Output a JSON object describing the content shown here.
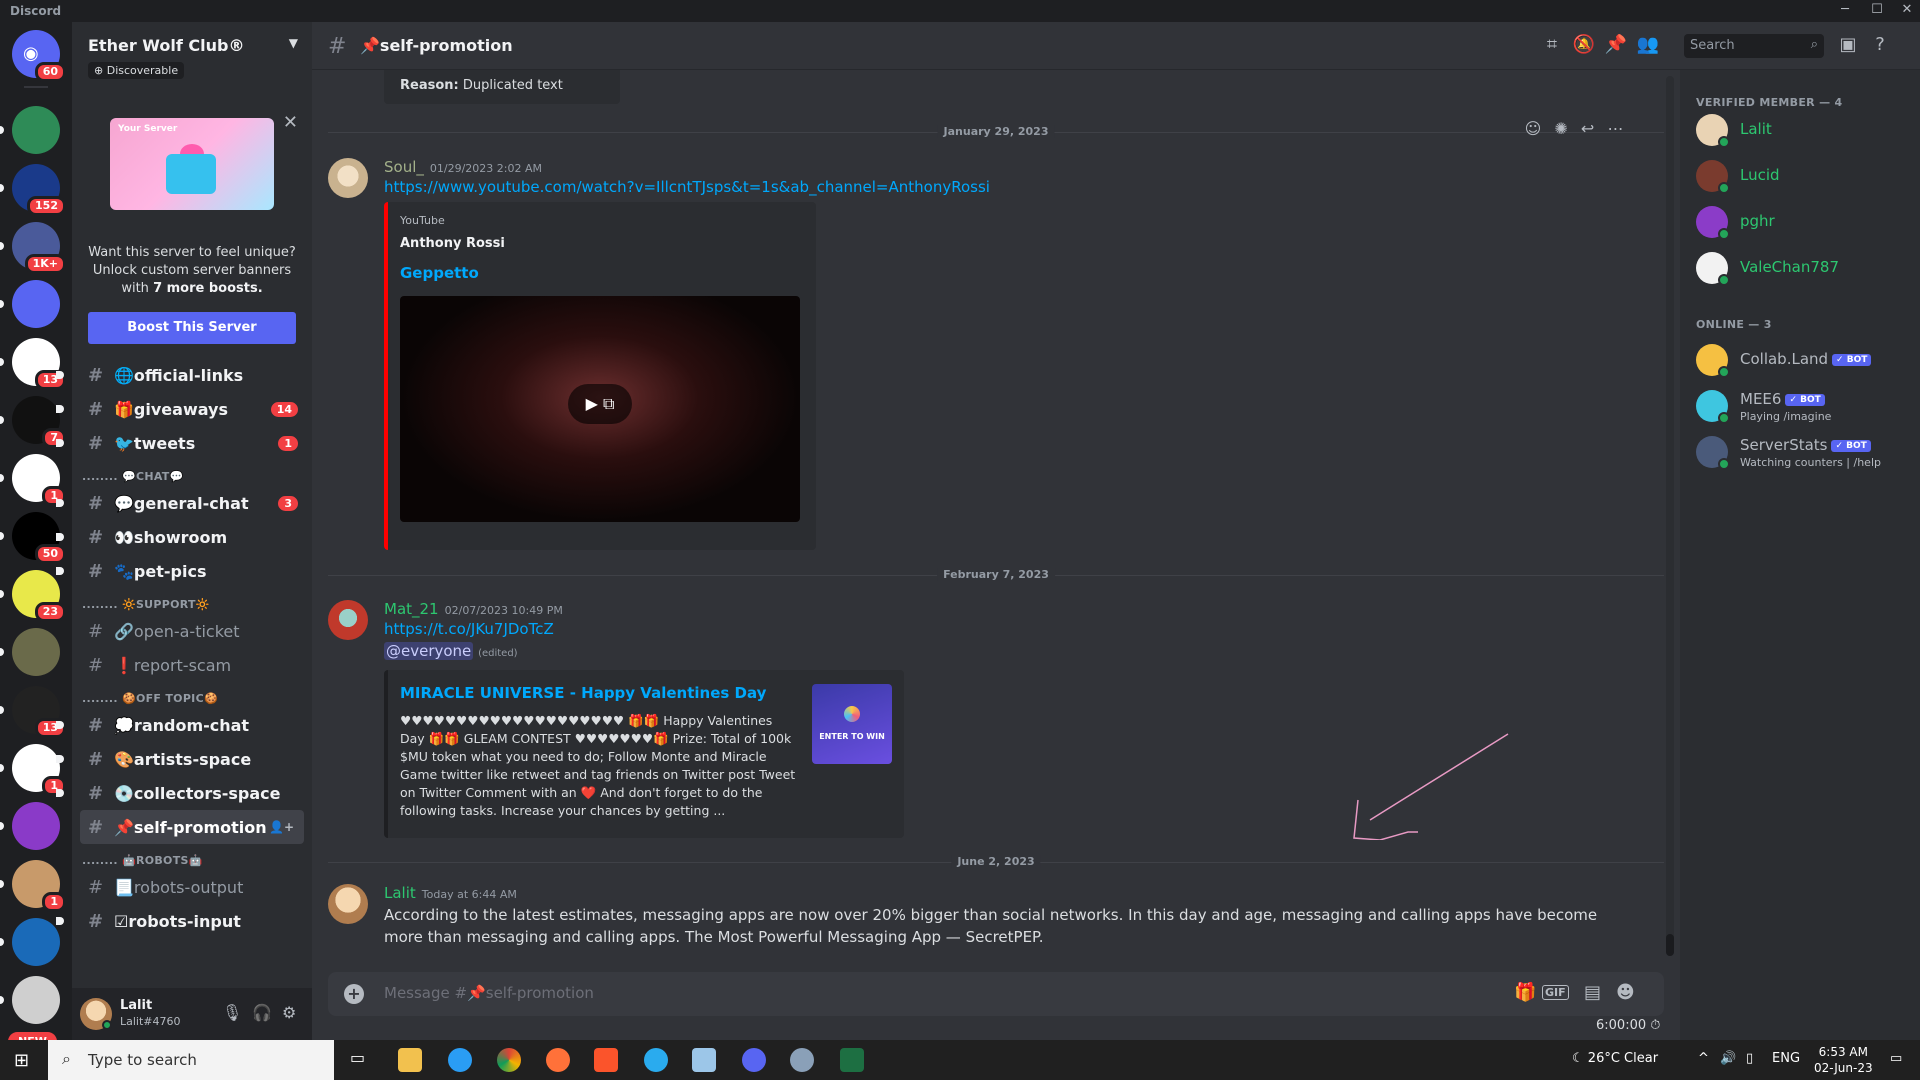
{
  "window": {
    "title": "Discord"
  },
  "rail": {
    "dm_badge": "60",
    "servers": [
      {
        "badge": "",
        "color": "#2e8b57"
      },
      {
        "badge": "152",
        "color": "#1a3a8a"
      },
      {
        "badge": "1K+",
        "color": "#4a5a9a"
      },
      {
        "badge": "",
        "color": "#5865f2"
      },
      {
        "badge": "13",
        "color": "#ffffff"
      },
      {
        "badge": "7",
        "color": "#111111"
      },
      {
        "badge": "1",
        "color": "#ffffff"
      },
      {
        "badge": "50",
        "color": "#000000"
      },
      {
        "badge": "23",
        "color": "#e8e84a"
      },
      {
        "badge": "",
        "color": "#6a6a4a"
      },
      {
        "badge": "13",
        "color": "#222222"
      },
      {
        "badge": "1",
        "color": "#ffffff"
      },
      {
        "badge": "",
        "color": "#8a3ac8"
      },
      {
        "badge": "1",
        "color": "#c89a6a"
      },
      {
        "badge": "",
        "color": "#1a6ab8"
      },
      {
        "badge": "",
        "color": "#cfcfcf"
      }
    ],
    "new_label": "NEW"
  },
  "server": {
    "name": "Ether Wolf Club®",
    "discoverable": "Discoverable",
    "boost": {
      "card_label": "Your Server",
      "text_line": "Want this server to feel unique? Unlock custom server banners with",
      "text_bold": "7 more boosts.",
      "button": "Boost This Server"
    }
  },
  "channels": [
    {
      "type": "channel",
      "name": "🌐official-links",
      "unread": true,
      "count": ""
    },
    {
      "type": "channel",
      "name": "🎁giveaways",
      "unread": true,
      "count": "14"
    },
    {
      "type": "channel",
      "name": "🐦tweets",
      "unread": true,
      "count": "1"
    },
    {
      "type": "category",
      "name": "........ 💬CHAT💬"
    },
    {
      "type": "channel",
      "name": "💬general-chat",
      "unread": true,
      "count": "3"
    },
    {
      "type": "channel",
      "name": "👀showroom",
      "unread": true,
      "count": ""
    },
    {
      "type": "channel",
      "name": "🐾pet-pics",
      "unread": true,
      "count": ""
    },
    {
      "type": "category",
      "name": "........ 🔆SUPPORT🔆"
    },
    {
      "type": "channel",
      "name": "🔗open-a-ticket",
      "unread": false,
      "count": ""
    },
    {
      "type": "channel",
      "name": "❗report-scam",
      "unread": false,
      "count": ""
    },
    {
      "type": "category",
      "name": "........ 🍪OFF TOPIC🍪"
    },
    {
      "type": "channel",
      "name": "💭random-chat",
      "unread": true,
      "count": ""
    },
    {
      "type": "channel",
      "name": "🎨artists-space",
      "unread": true,
      "count": ""
    },
    {
      "type": "channel",
      "name": "💿collectors-space",
      "unread": true,
      "count": ""
    },
    {
      "type": "channel",
      "name": "📌self-promotion",
      "active": true,
      "count": ""
    },
    {
      "type": "category",
      "name": "........ 🤖ROBOTS🤖"
    },
    {
      "type": "channel",
      "name": "📃robots-output",
      "unread": false,
      "count": ""
    },
    {
      "type": "channel",
      "name": "☑robots-input",
      "unread": true,
      "count": ""
    }
  ],
  "user": {
    "name": "Lalit",
    "tag": "Lalit#4760"
  },
  "header": {
    "channel": "📌self-promotion",
    "search_placeholder": "Search"
  },
  "messages": {
    "reason_label": "Reason:",
    "reason_text": "Duplicated text",
    "date1": "January 29, 2023",
    "msg1": {
      "author": "Soul_",
      "time": "01/29/2023 2:02 AM",
      "link": "https://www.youtube.com/watch?v=IllcntTJsps&t=1s&ab_channel=AnthonyRossi",
      "embed_provider": "YouTube",
      "embed_author": "Anthony Rossi",
      "embed_title": "Geppetto"
    },
    "date2": "February 7, 2023",
    "msg2": {
      "author": "Mat_21",
      "time": "02/07/2023 10:49 PM",
      "link": "https://t.co/JKu7JDoTcZ",
      "mention": "@everyone",
      "edited": "(edited)",
      "embed_title": "MIRACLE UNIVERSE -  Happy Valentines Day",
      "embed_desc": "♥♥♥♥♥♥♥♥♥♥♥♥♥♥♥♥♥♥♥♥ 🎁🎁 Happy Valentines Day 🎁🎁 GLEAM CONTEST ♥♥♥♥♥♥♥🎁 Prize: Total of 100k $MU token what you need to do; Follow Monte and Miracle Game twitter like retweet and tag friends on Twitter post Tweet on Twitter Comment with an ❤️ And don't forget to do the following tasks. Increase your chances by getting ...",
      "thumb_text": "ENTER TO WIN"
    },
    "date3": "June 2, 2023",
    "msg3": {
      "author": "Lalit",
      "time": "Today at 6:44 AM",
      "text": "According to the latest estimates, messaging apps are now over 20% bigger than social networks. In this day and age, messaging and calling apps have become more than messaging and calling apps. The Most Powerful Messaging App — SecretPEP."
    }
  },
  "composer": {
    "placeholder": "Message #📌self-promotion",
    "timer": "6:00:00"
  },
  "members": {
    "verified_header": "VERIFIED MEMBER — 4",
    "verified": [
      {
        "name": "Lalit",
        "color": "#2dc770"
      },
      {
        "name": "Lucid",
        "color": "#2dc770"
      },
      {
        "name": "pghr",
        "color": "#2dc770"
      },
      {
        "name": "ValeChan787",
        "color": "#2dc770"
      }
    ],
    "online_header": "ONLINE — 3",
    "online": [
      {
        "name": "Collab.Land",
        "bot": "✓ BOT",
        "sub": ""
      },
      {
        "name": "MEE6",
        "bot": "✓ BOT",
        "sub": "Playing /imagine"
      },
      {
        "name": "ServerStats",
        "bot": "✓ BOT",
        "sub": "Watching counters | /help"
      }
    ]
  },
  "taskbar": {
    "search_placeholder": "Type to search",
    "weather": "26°C  Clear",
    "lang": "ENG",
    "time": "6:53 AM",
    "date": "02-Jun-23"
  }
}
